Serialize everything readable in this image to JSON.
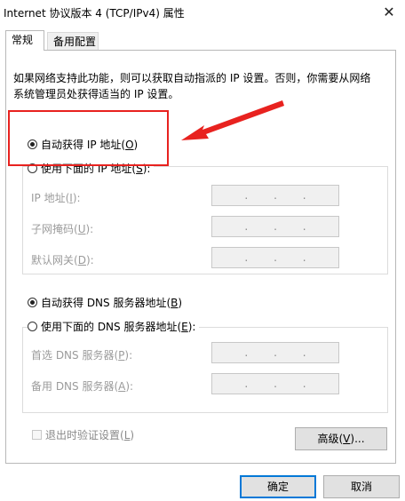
{
  "window": {
    "title": "Internet 协议版本 4 (TCP/IPv4) 属性",
    "close_glyph": "✕"
  },
  "tabs": [
    {
      "label": "常规",
      "active": true
    },
    {
      "label": "备用配置",
      "active": false
    }
  ],
  "description": "如果网络支持此功能，则可以获取自动指派的 IP 设置。否则，你需要从网络系统管理员处获得适当的 IP 设置。",
  "ip_section": {
    "auto_label": "自动获得 IP 地址",
    "auto_key": "O",
    "manual_label": "使用下面的 IP 地址",
    "manual_key": "S",
    "fields": [
      {
        "label": "IP 地址",
        "key": "I"
      },
      {
        "label": "子网掩码",
        "key": "U"
      },
      {
        "label": "默认网关",
        "key": "D"
      }
    ]
  },
  "dns_section": {
    "auto_label": "自动获得 DNS 服务器地址",
    "auto_key": "B",
    "manual_label": "使用下面的 DNS 服务器地址",
    "manual_key": "E",
    "fields": [
      {
        "label": "首选 DNS 服务器",
        "key": "P"
      },
      {
        "label": "备用 DNS 服务器",
        "key": "A"
      }
    ]
  },
  "ip_placeholder_dots": ".",
  "validate_checkbox": {
    "label": "退出时验证设置",
    "key": "L",
    "checked": false
  },
  "buttons": {
    "advanced": "高级",
    "advanced_key": "V",
    "advanced_suffix": "...",
    "ok": "确定",
    "cancel": "取消"
  },
  "annotation_color": "#e8221f"
}
